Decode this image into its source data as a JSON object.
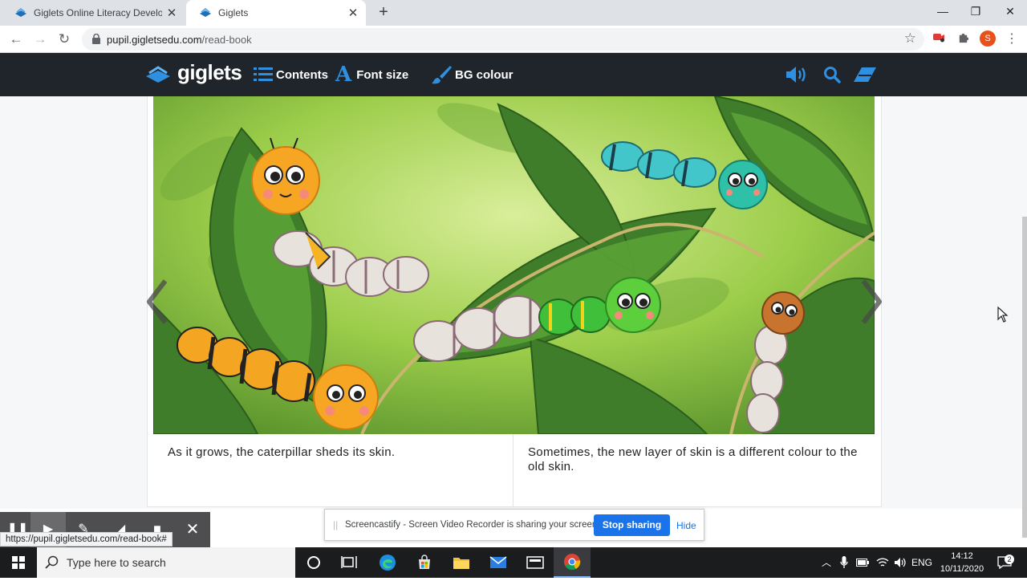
{
  "browser": {
    "tabs": [
      {
        "title": "Giglets Online Literacy Developm",
        "active": false
      },
      {
        "title": "Giglets",
        "active": true
      }
    ],
    "new_tab": "+",
    "url_domain": "pupil.gigletsedu.com",
    "url_path": "/read-book",
    "profile_initial": "S",
    "window_controls": {
      "minimize": "—",
      "restore": "❐",
      "close": "✕"
    }
  },
  "site": {
    "logo": "giglets",
    "nav": {
      "contents": "Contents",
      "font_size": "Font size",
      "bg_colour": "BG colour"
    },
    "icons": [
      "speaker-icon",
      "search-icon",
      "eraser-icon"
    ]
  },
  "book": {
    "left_caption": "As it grows, the caterpillar sheds its skin.",
    "right_caption": "Sometimes, the new layer of skin is a different colour to the old skin.",
    "prev": "previous-page",
    "next": "next-page"
  },
  "screencastify": {
    "message": "Screencastify - Screen Video Recorder is sharing your screen.",
    "stop_label": "Stop sharing",
    "hide_label": "Hide"
  },
  "status_url": "https://pupil.gigletsedu.com/read-book#",
  "taskbar": {
    "search_placeholder": "Type here to search",
    "language": "ENG",
    "time": "14:12",
    "date": "10/11/2020",
    "notification_count": "2"
  },
  "colors": {
    "site_nav_bg": "#1f252b",
    "accent_blue": "#2f8fe0",
    "stop_button": "#1a73e8"
  }
}
